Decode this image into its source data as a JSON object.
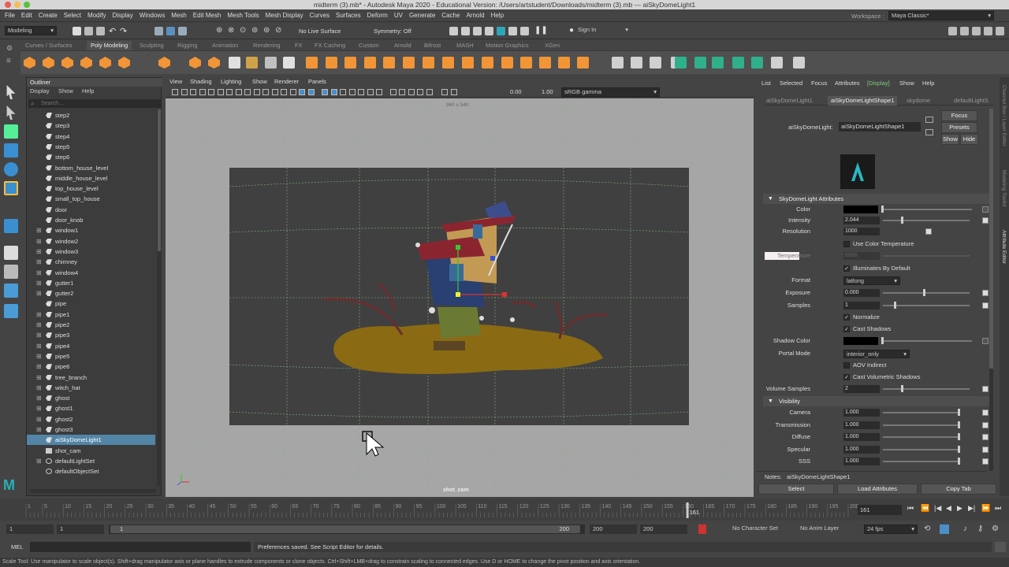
{
  "window": {
    "title": "midterm (3).mb* - Autodesk Maya 2020 - Educational Version: /Users/artstudent/Downloads/midterm (3).mb  ---  aiSkyDomeLight1",
    "traffic_colors": [
      "#ee5c55",
      "#f5be4f",
      "#58c33a"
    ]
  },
  "menubar": {
    "items": [
      "File",
      "Edit",
      "Create",
      "Select",
      "Modify",
      "Display",
      "Windows",
      "Mesh",
      "Edit Mesh",
      "Mesh Tools",
      "Mesh Display",
      "Curves",
      "Surfaces",
      "Deform",
      "UV",
      "Generate",
      "Cache",
      "Arnold",
      "Help"
    ],
    "workspace_label": "Workspace :",
    "workspace_value": "Maya Classic*"
  },
  "statusline": {
    "menuset": "Modeling",
    "live_surface": "No Live Surface",
    "symmetry": "Symmetry: Off",
    "sign_in": "Sign In"
  },
  "shelf": {
    "tabs": [
      "Curves / Surfaces",
      "Poly Modeling",
      "Sculpting",
      "Rigging",
      "Animation",
      "Rendering",
      "FX",
      "FX Caching",
      "Custom",
      "Arnold",
      "Bifrost",
      "MASH",
      "Motion Graphics",
      "XGen"
    ],
    "active_tab": "Poly Modeling"
  },
  "outliner": {
    "title": "Outliner",
    "menu": [
      "Display",
      "Show",
      "Help"
    ],
    "search_placeholder": "Search...",
    "items": [
      {
        "label": "step2",
        "expand": false
      },
      {
        "label": "step3",
        "expand": false
      },
      {
        "label": "step4",
        "expand": false
      },
      {
        "label": "step5",
        "expand": false
      },
      {
        "label": "step6",
        "expand": false
      },
      {
        "label": "bottom_house_level",
        "expand": false
      },
      {
        "label": "middle_house_level",
        "expand": false
      },
      {
        "label": "top_house_level",
        "expand": false
      },
      {
        "label": "small_top_house",
        "expand": false
      },
      {
        "label": "door",
        "expand": false
      },
      {
        "label": "door_knob",
        "expand": false
      },
      {
        "label": "window1",
        "expand": true
      },
      {
        "label": "window2",
        "expand": true
      },
      {
        "label": "window3",
        "expand": true
      },
      {
        "label": "chimney",
        "expand": true
      },
      {
        "label": "window4",
        "expand": true
      },
      {
        "label": "gutter1",
        "expand": true
      },
      {
        "label": "gutter2",
        "expand": true
      },
      {
        "label": "pipe",
        "expand": false
      },
      {
        "label": "pipe1",
        "expand": true
      },
      {
        "label": "pipe2",
        "expand": true
      },
      {
        "label": "pipe3",
        "expand": true
      },
      {
        "label": "pipe4",
        "expand": true
      },
      {
        "label": "pipe5",
        "expand": true
      },
      {
        "label": "pipe6",
        "expand": true
      },
      {
        "label": "tree_branch",
        "expand": true
      },
      {
        "label": "witch_hat",
        "expand": true
      },
      {
        "label": "ghost",
        "expand": true
      },
      {
        "label": "ghost1",
        "expand": true
      },
      {
        "label": "ghost2",
        "expand": true
      },
      {
        "label": "ghost3",
        "expand": true
      },
      {
        "label": "aiSkyDomeLight1",
        "expand": false,
        "selected": true
      },
      {
        "label": "shot_cam",
        "expand": false
      },
      {
        "label": "defaultLightSet",
        "expand": true
      },
      {
        "label": "defaultObjectSet",
        "expand": false
      }
    ]
  },
  "viewport": {
    "menu": [
      "View",
      "Shading",
      "Lighting",
      "Show",
      "Renderer",
      "Panels"
    ],
    "resolution_label": "960 x 540",
    "camera_label": "shot_cam",
    "near_value": "0.00",
    "far_value": "1.00",
    "color_space": "sRGB gamma"
  },
  "attribute_editor": {
    "menu": [
      "List",
      "Selected",
      "Focus",
      "Attributes",
      "[Display]",
      "Show",
      "Help"
    ],
    "tabs": [
      "aiSkyDomeLight1",
      "aiSkyDomeLightShape1",
      "skydome",
      "defaultLightS"
    ],
    "active_tab": "aiSkyDomeLightShape1",
    "node_label": "aiSkyDomeLight:",
    "node_value": "aiSkyDomeLightShape1",
    "focus_btn": "Focus",
    "presets_btn": "Presets",
    "show_btn": "Show",
    "hide_btn": "Hide",
    "section1": "SkyDomeLight Attributes",
    "color_label": "Color",
    "intensity_label": "Intensity",
    "intensity_value": "2.044",
    "resolution_label": "Resolution",
    "resolution_value": "1000",
    "use_color_temp": "Use Color Temperature",
    "temperature_label": "Temperature",
    "temperature_value": "6500",
    "illuminates": "Illuminates By Default",
    "format_label": "Format",
    "format_value": "latlong",
    "exposure_label": "Exposure",
    "exposure_value": "0.000",
    "samples_label": "Samples",
    "samples_value": "1",
    "normalize": "Normalize",
    "cast_shadows": "Cast Shadows",
    "shadow_color_label": "Shadow Color",
    "portal_mode_label": "Portal Mode",
    "portal_mode_value": "interior_only",
    "aov_indirect": "AOV Indirect",
    "cast_vol_shadows": "Cast Volumetric Shadows",
    "volume_samples_label": "Volume Samples",
    "volume_samples_value": "2",
    "section2": "Visibility",
    "vis": [
      {
        "label": "Camera",
        "value": "1.000"
      },
      {
        "label": "Transmission",
        "value": "1.000"
      },
      {
        "label": "Diffuse",
        "value": "1.000"
      },
      {
        "label": "Specular",
        "value": "1.000"
      },
      {
        "label": "SSS",
        "value": "1.000"
      }
    ],
    "notes_label": "Notes:",
    "notes_value": "aiSkyDomeLightShape1",
    "select_btn": "Select",
    "load_attrs_btn": "Load Attributes",
    "copy_tab_btn": "Copy Tab",
    "side_tabs": [
      "Channel Box / Layer Editor",
      "Modeling Toolkit",
      "Attribute Editor"
    ]
  },
  "timeline": {
    "ticks": [
      "1",
      "5",
      "10",
      "15",
      "20",
      "25",
      "30",
      "35",
      "40",
      "45",
      "50",
      "55",
      "60",
      "65",
      "70",
      "75",
      "80",
      "85",
      "90",
      "95",
      "100",
      "105",
      "110",
      "115",
      "120",
      "125",
      "130",
      "135",
      "140",
      "145",
      "150",
      "155",
      "160",
      "165",
      "170",
      "175",
      "180",
      "185",
      "190",
      "195",
      "200"
    ],
    "current_frame_marker": "161",
    "current_frame": "161"
  },
  "range": {
    "start": "1",
    "start2": "1",
    "slider_start": "1",
    "slider_end": "200",
    "end": "200",
    "end2": "200",
    "character_set": "No Character Set",
    "anim_layer": "No Anim Layer",
    "fps": "24 fps"
  },
  "command_line": {
    "label": "MEL",
    "result": "Preferences saved. See Script Editor for details."
  },
  "help_line": "Scale Tool: Use manipulator to scale object(s). Shift+drag manipulator axis or plane handles to extrude components or clone objects. Ctrl+Shift+LMB+drag to constrain scaling to connected edges. Use D or HOME to change the pivot position and axis orientation."
}
